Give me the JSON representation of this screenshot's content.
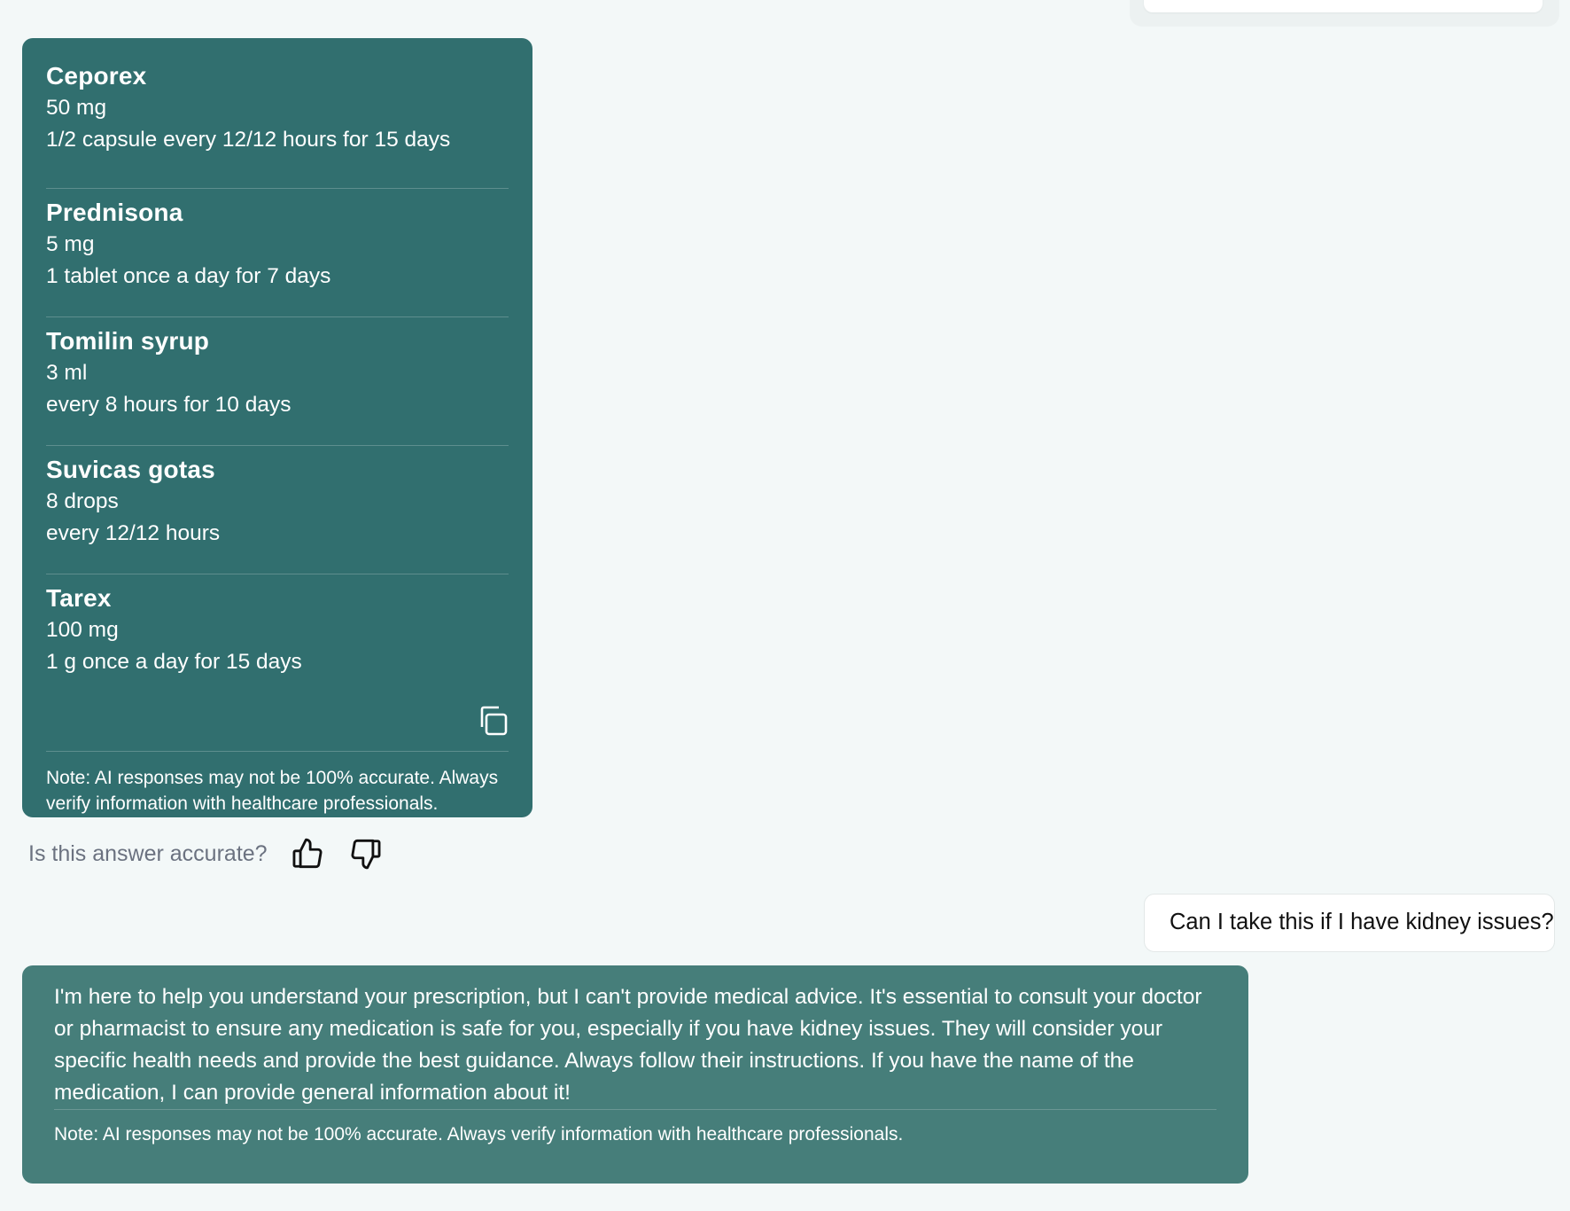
{
  "prescription": {
    "medications": [
      {
        "name": "Ceporex",
        "dose": "50 mg",
        "frequency": "1/2 capsule every 12/12 hours for 15 days"
      },
      {
        "name": "Prednisona",
        "dose": "5 mg",
        "frequency": "1 tablet once a day for 7 days"
      },
      {
        "name": "Tomilin syrup",
        "dose": "3 ml",
        "frequency": "every 8 hours for 10 days"
      },
      {
        "name": "Suvicas gotas",
        "dose": "8 drops",
        "frequency": "every 12/12 hours"
      },
      {
        "name": "Tarex",
        "dose": "100 mg",
        "frequency": "1 g once a day for 15 days"
      }
    ],
    "note": "Note: AI responses may not be 100% accurate. Always verify information with healthcare professionals.",
    "copy_icon": "copy-icon"
  },
  "feedback": {
    "question": "Is this answer accurate?",
    "thumbs_up_icon": "thumbs-up-icon",
    "thumbs_down_icon": "thumbs-down-icon"
  },
  "user_message": {
    "text": "Can I take this if I have kidney issues?"
  },
  "assistant_reply": {
    "text": "I'm here to help you understand your prescription, but I can't provide medical advice. It's essential to consult your doctor or pharmacist to ensure any medication is safe for you, especially if you have kidney issues. They will consider your specific health needs and provide the best guidance. Always follow their instructions. If you have the name of the medication, I can provide general information about it!",
    "note": "Note: AI responses may not be 100% accurate. Always verify information with healthcare professionals."
  },
  "colors": {
    "page_background": "#f3f8f8",
    "prescription_card": "#316f6f",
    "reply_card": "#467e7a",
    "feedback_text": "#6b7280"
  }
}
